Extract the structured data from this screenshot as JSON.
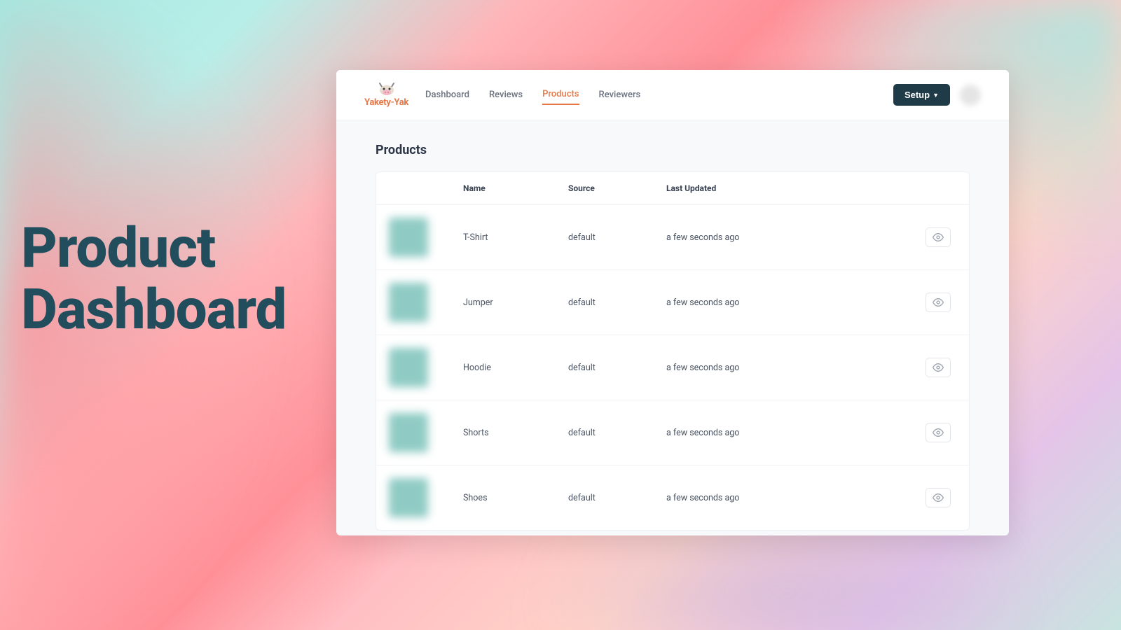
{
  "slide": {
    "title_line1": "Product",
    "title_line2": "Dashboard"
  },
  "app": {
    "brand": "Yakety-Yak",
    "nav": {
      "dashboard": "Dashboard",
      "reviews": "Reviews",
      "products": "Products",
      "reviewers": "Reviewers"
    },
    "setup_label": "Setup",
    "page_title": "Products",
    "columns": {
      "name": "Name",
      "source": "Source",
      "updated": "Last Updated"
    },
    "products": [
      {
        "name": "T-Shirt",
        "source": "default",
        "updated": "a few seconds ago"
      },
      {
        "name": "Jumper",
        "source": "default",
        "updated": "a few seconds ago"
      },
      {
        "name": "Hoodie",
        "source": "default",
        "updated": "a few seconds ago"
      },
      {
        "name": "Shorts",
        "source": "default",
        "updated": "a few seconds ago"
      },
      {
        "name": "Shoes",
        "source": "default",
        "updated": "a few seconds ago"
      }
    ]
  }
}
